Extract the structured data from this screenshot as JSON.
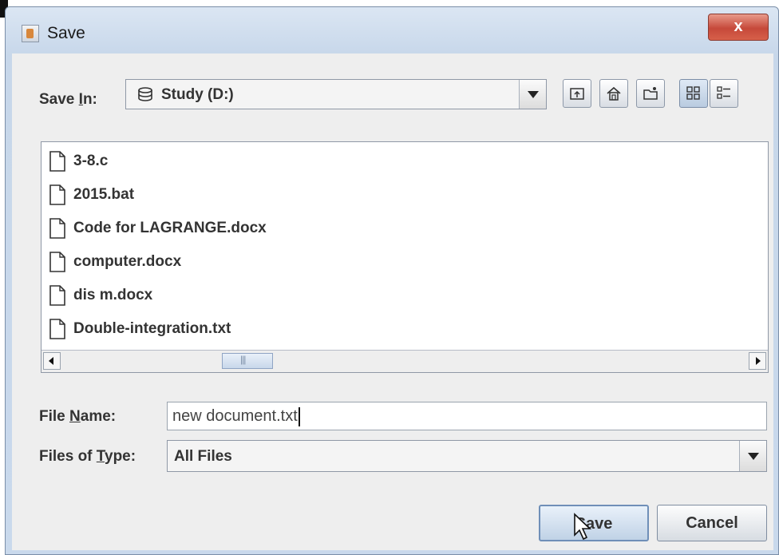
{
  "window": {
    "title": "Save",
    "close_label": "x"
  },
  "save_in": {
    "label": "Save In:",
    "value": "Study  (D:)"
  },
  "toolbar": {
    "buttons": [
      {
        "name": "up-one-level-icon"
      },
      {
        "name": "home-icon"
      },
      {
        "name": "new-folder-icon"
      },
      {
        "name": "list-view-icon",
        "active": true
      },
      {
        "name": "details-view-icon"
      }
    ]
  },
  "files": [
    {
      "name": "3-8.c"
    },
    {
      "name": "2015.bat"
    },
    {
      "name": "Code for LAGRANGE.docx"
    },
    {
      "name": "computer.docx"
    },
    {
      "name": "dis m.docx"
    },
    {
      "name": "Double-integration.txt"
    }
  ],
  "file_name": {
    "label": "File Name:",
    "value": "new document.txt"
  },
  "files_of_type": {
    "label": "Files of Type:",
    "value": "All Files"
  },
  "buttons": {
    "save": "Save",
    "cancel": "Cancel"
  },
  "colors": {
    "accent": "#6f8fb8",
    "close": "#c6493a"
  }
}
